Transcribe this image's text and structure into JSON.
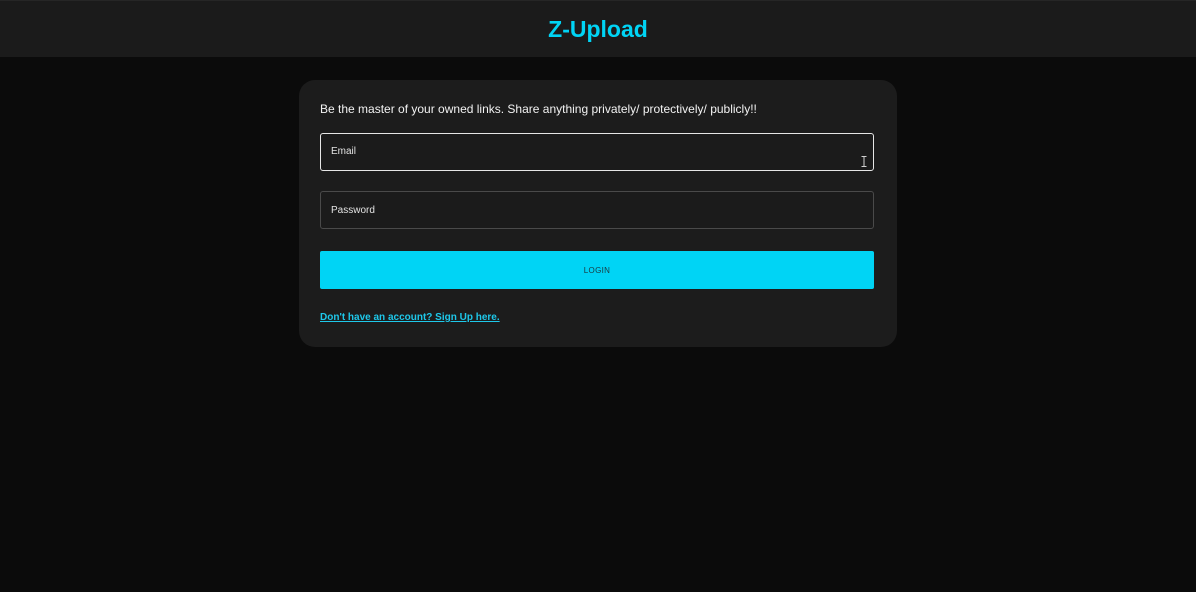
{
  "header": {
    "brand": "Z-Upload"
  },
  "login_card": {
    "tagline": "Be the master of your owned links. Share anything privately/ protectively/ publicly!!",
    "email": {
      "placeholder": "Email",
      "value": ""
    },
    "password": {
      "placeholder": "Password",
      "value": ""
    },
    "login_label": "LOGIN",
    "signup_link": "Don't have an account? Sign Up here."
  },
  "colors": {
    "accent": "#00d4f5",
    "page_background": "#0b0b0b",
    "header_background": "#1b1b1b",
    "card_background": "#1c1c1c"
  },
  "icons": {
    "cursor": "text-cursor-icon"
  }
}
